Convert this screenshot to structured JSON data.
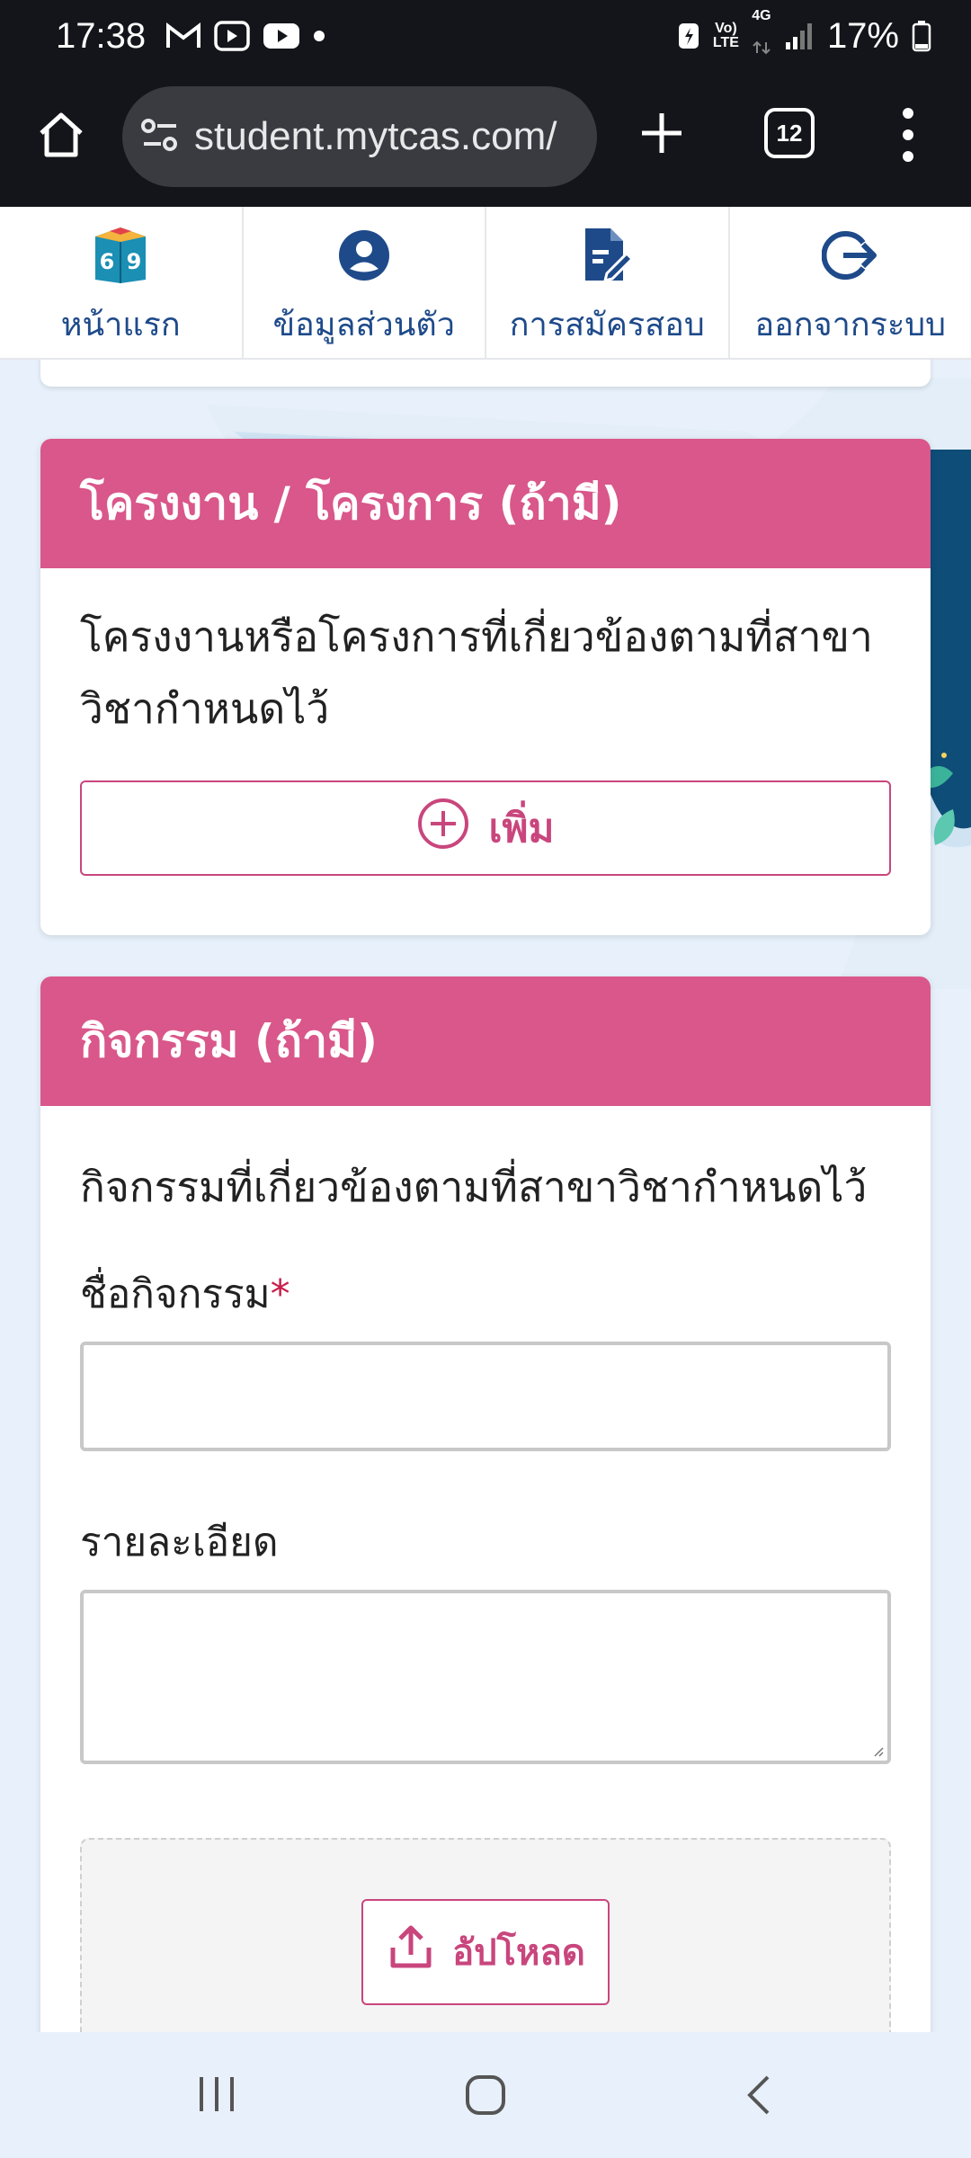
{
  "status_bar": {
    "time": "17:38",
    "network_top": "Vo)",
    "network_bottom": "LTE",
    "net_type": "4G",
    "battery": "17%"
  },
  "browser": {
    "url": "student.mytcas.com/",
    "tab_count": "12"
  },
  "topnav": {
    "items": [
      {
        "label": "หน้าแรก",
        "icon": "book-69-icon"
      },
      {
        "label": "ข้อมูลส่วนตัว",
        "icon": "user-circle-icon"
      },
      {
        "label": "การสมัครสอบ",
        "icon": "document-edit-icon"
      },
      {
        "label": "ออกจากระบบ",
        "icon": "logout-icon"
      }
    ],
    "book_digits": [
      "6",
      "9"
    ]
  },
  "projects_card": {
    "title": "โครงงาน / โครงการ (ถ้ามี)",
    "description": "โครงงานหรือโครงการที่เกี่ยวข้องตามที่สาขาวิชากำหนดไว้",
    "add_label": "เพิ่ม"
  },
  "activities_card": {
    "title": "กิจกรรม (ถ้ามี)",
    "description": "กิจกรรมที่เกี่ยวข้องตามที่สาขาวิชากำหนดไว้",
    "name_label": "ชื่อกิจกรรม",
    "required_mark": "*",
    "name_value": "",
    "detail_label": "รายละเอียด",
    "detail_value": "",
    "upload_label": "อัปโหลด"
  },
  "colors": {
    "accent": "#d9578a",
    "nav_text": "#1e4a8a"
  }
}
